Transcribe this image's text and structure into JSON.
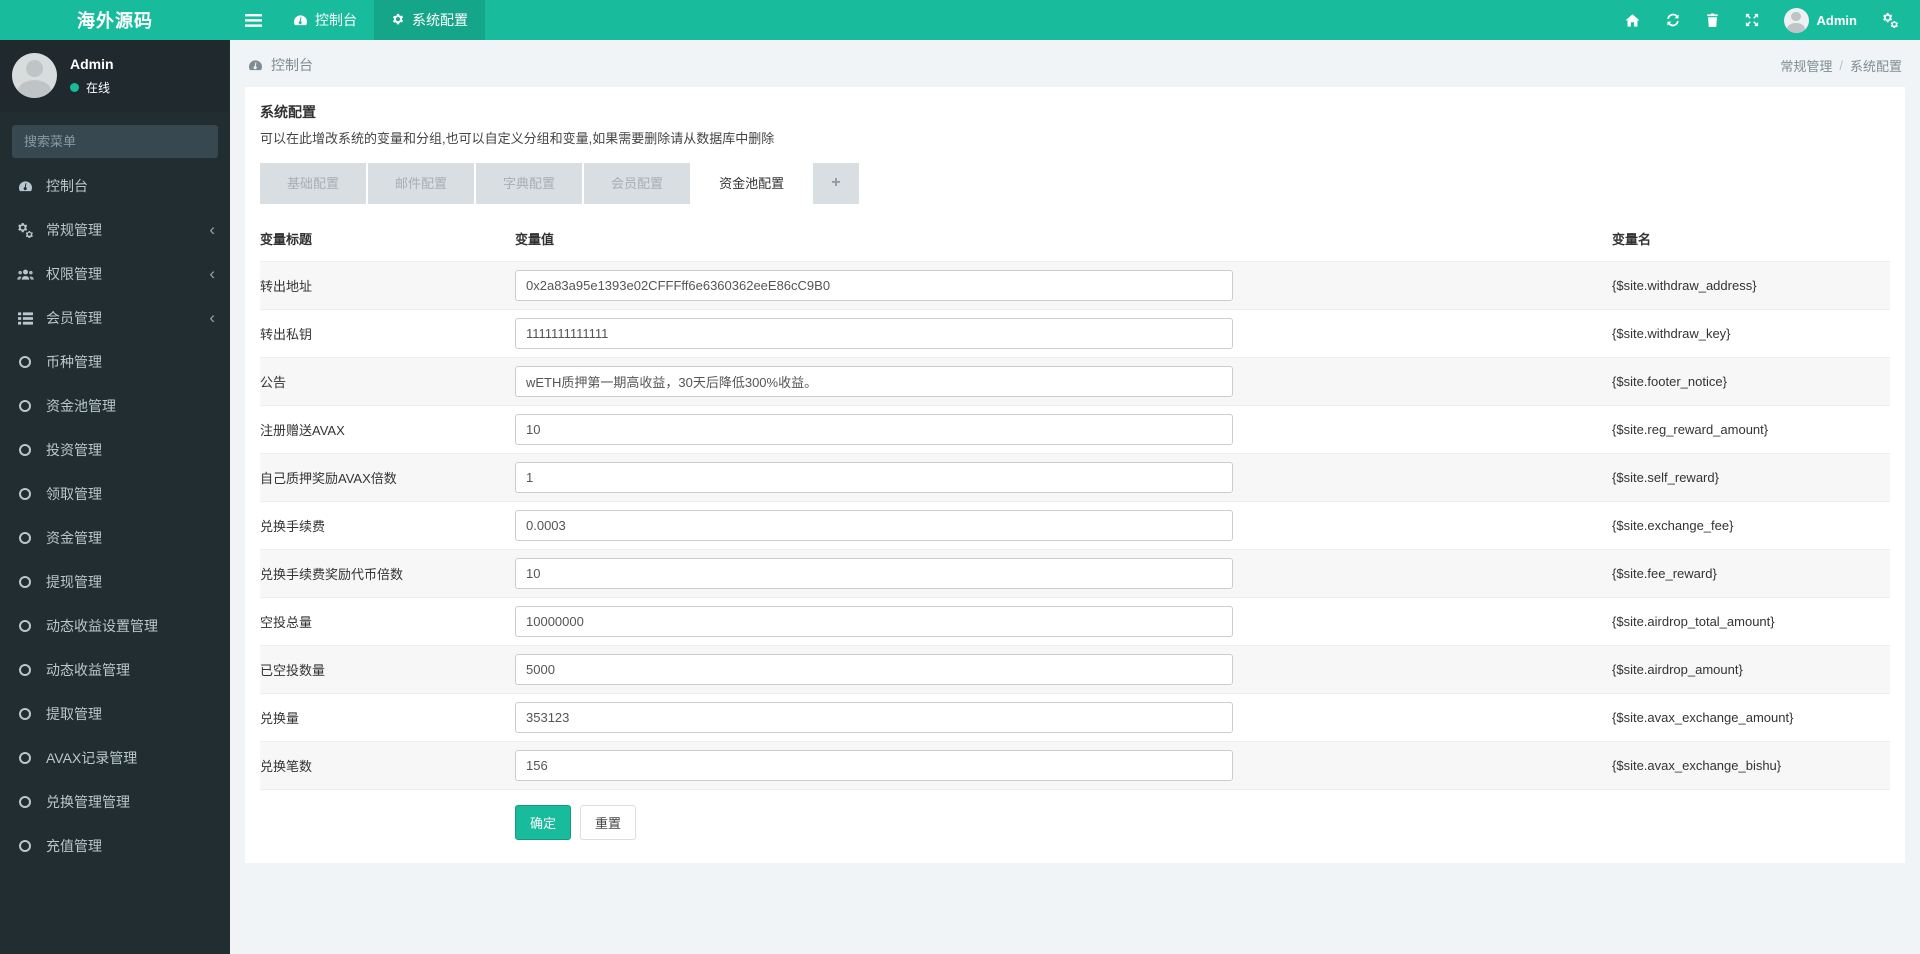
{
  "colors": {
    "accent": "#18bc9c",
    "navbar_active": "#15a589",
    "sidebar_bg": "#222d32"
  },
  "navbar": {
    "brand": "海外源码",
    "menu": [
      {
        "label": "控制台",
        "icon": "dashboard",
        "active": false
      },
      {
        "label": "系统配置",
        "icon": "gear",
        "active": true
      }
    ],
    "right_icons": [
      {
        "name": "home-icon",
        "icon": "home"
      },
      {
        "name": "refresh-icon",
        "icon": "refresh"
      },
      {
        "name": "trash-icon",
        "icon": "trash"
      },
      {
        "name": "fullscreen-icon",
        "icon": "expand"
      }
    ],
    "user_label": "Admin",
    "settings_icon": "cogs"
  },
  "sidebar": {
    "user": {
      "name": "Admin",
      "status": "在线"
    },
    "search_placeholder": "搜索菜单",
    "items": [
      {
        "label": "控制台",
        "icon": "dashboard",
        "chevron": false
      },
      {
        "label": "常规管理",
        "icon": "cogs",
        "chevron": true
      },
      {
        "label": "权限管理",
        "icon": "users",
        "chevron": true
      },
      {
        "label": "会员管理",
        "icon": "list",
        "chevron": true
      },
      {
        "label": "币种管理",
        "icon": "circle",
        "chevron": false
      },
      {
        "label": "资金池管理",
        "icon": "circle",
        "chevron": false
      },
      {
        "label": "投资管理",
        "icon": "circle",
        "chevron": false
      },
      {
        "label": "领取管理",
        "icon": "circle",
        "chevron": false
      },
      {
        "label": "资金管理",
        "icon": "circle",
        "chevron": false
      },
      {
        "label": "提现管理",
        "icon": "circle",
        "chevron": false
      },
      {
        "label": "动态收益设置管理",
        "icon": "circle",
        "chevron": false
      },
      {
        "label": "动态收益管理",
        "icon": "circle",
        "chevron": false
      },
      {
        "label": "提取管理",
        "icon": "circle",
        "chevron": false
      },
      {
        "label": "AVAX记录管理",
        "icon": "circle",
        "chevron": false
      },
      {
        "label": "兑换管理管理",
        "icon": "circle",
        "chevron": false
      },
      {
        "label": "充值管理",
        "icon": "circle",
        "chevron": false
      }
    ]
  },
  "content": {
    "header_left": "控制台",
    "breadcrumb": [
      "常规管理",
      "系统配置"
    ],
    "panel": {
      "title": "系统配置",
      "subtitle": "可以在此增改系统的变量和分组,也可以自定义分组和变量,如果需要删除请从数据库中删除",
      "tabs": [
        "基础配置",
        "邮件配置",
        "字典配置",
        "会员配置",
        "资金池配置"
      ],
      "active_tab": "资金池配置",
      "add_tab_label": "+",
      "table": {
        "headers": [
          "变量标题",
          "变量值",
          "变量名"
        ],
        "rows": [
          {
            "title": "转出地址",
            "value": "0x2a83a95e1393e02CFFFff6e6360362eeE86cC9B0",
            "name": "{$site.withdraw_address}"
          },
          {
            "title": "转出私钥",
            "value": "1111111111111",
            "name": "{$site.withdraw_key}"
          },
          {
            "title": "公告",
            "value": "wETH质押第一期高收益，30天后降低300%收益。",
            "name": "{$site.footer_notice}"
          },
          {
            "title": "注册赠送AVAX",
            "value": "10",
            "name": "{$site.reg_reward_amount}"
          },
          {
            "title": "自己质押奖励AVAX倍数",
            "value": "1",
            "name": "{$site.self_reward}"
          },
          {
            "title": "兑换手续费",
            "value": "0.0003",
            "name": "{$site.exchange_fee}"
          },
          {
            "title": "兑换手续费奖励代币倍数",
            "value": "10",
            "name": "{$site.fee_reward}"
          },
          {
            "title": "空投总量",
            "value": "10000000",
            "name": "{$site.airdrop_total_amount}"
          },
          {
            "title": "已空投数量",
            "value": "5000",
            "name": "{$site.airdrop_amount}"
          },
          {
            "title": "兑换量",
            "value": "353123",
            "name": "{$site.avax_exchange_amount}"
          },
          {
            "title": "兑换笔数",
            "value": "156",
            "name": "{$site.avax_exchange_bishu}"
          }
        ]
      },
      "buttons": {
        "submit": "确定",
        "reset": "重置"
      }
    }
  }
}
